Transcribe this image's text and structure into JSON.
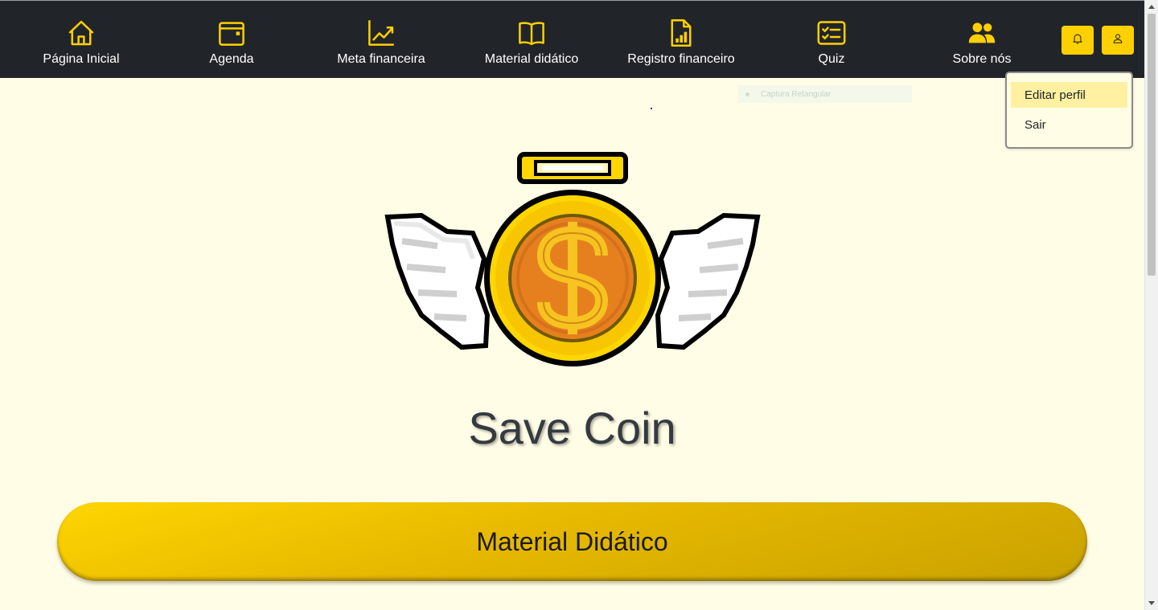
{
  "nav": {
    "items": [
      {
        "label": "Página Inicial",
        "icon": "house-icon"
      },
      {
        "label": "Agenda",
        "icon": "calendar-icon"
      },
      {
        "label": "Meta financeira",
        "icon": "graph-up-arrow-icon"
      },
      {
        "label": "Material didático",
        "icon": "book-icon"
      },
      {
        "label": "Registro financeiro",
        "icon": "file-bar-chart-icon"
      },
      {
        "label": "Quiz",
        "icon": "checklist-icon"
      },
      {
        "label": "Sobre nós",
        "icon": "people-icon"
      }
    ],
    "notification_icon": "bell-icon",
    "profile_icon": "person-icon"
  },
  "profile_menu": {
    "items": [
      "Editar perfil",
      "Sair"
    ],
    "highlighted": "Editar perfil"
  },
  "overlay": {
    "label": "Captura Retangular"
  },
  "hero": {
    "logo": "winged-coin-halo-logo",
    "title": "Save Coin"
  },
  "cta": {
    "label": "Material Didático"
  },
  "colors": {
    "navbar": "#212529",
    "accent": "#ffd000",
    "page_background": "#fffde6",
    "coin_inner": "#e6801e",
    "menu_highlight": "#fff1a1"
  }
}
